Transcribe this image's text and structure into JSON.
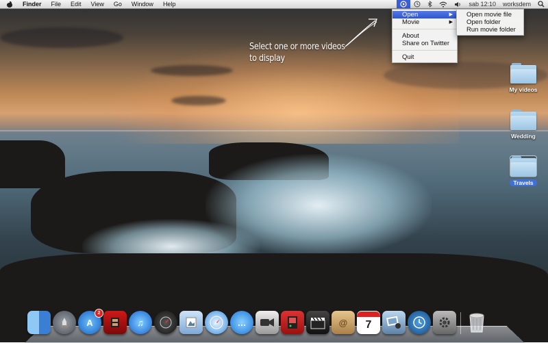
{
  "menubar": {
    "apple_icon": "apple-icon",
    "app_name": "Finder",
    "menus": [
      "File",
      "Edit",
      "View",
      "Go",
      "Window",
      "Help"
    ],
    "status": {
      "app_icon": "play-circle-icon",
      "icons": [
        "time-machine-icon",
        "bluetooth-icon",
        "wifi-icon",
        "volume-icon"
      ],
      "clock": "sab 12:10",
      "user": "worksdem",
      "search_icon": "spotlight-search-icon"
    }
  },
  "app_menu": {
    "items": [
      {
        "label": "Open",
        "has_submenu": true,
        "highlighted": true
      },
      {
        "label": "Movie",
        "has_submenu": true,
        "highlighted": false
      },
      {
        "label": "About",
        "has_submenu": false,
        "highlighted": false
      },
      {
        "label": "Share on Twitter",
        "has_submenu": false,
        "highlighted": false
      },
      {
        "label": "Quit",
        "has_submenu": false,
        "highlighted": false
      }
    ],
    "submenu": [
      "Open movie file",
      "Open folder",
      "Run movie folder"
    ]
  },
  "hint": {
    "line1": "Select one or more videos",
    "line2": "to display"
  },
  "desktop_items": [
    {
      "label": "My videos",
      "selected": false
    },
    {
      "label": "Wedding",
      "selected": false
    },
    {
      "label": "Travels",
      "selected": true
    }
  ],
  "dock": {
    "app_store_badge": "2",
    "calendar_day": "7",
    "items": [
      "finder-icon",
      "launchpad-icon",
      "app-store-icon",
      "photo-booth-icon",
      "itunes-icon",
      "dashboard-icon",
      "preview-icon",
      "safari-icon",
      "messages-icon",
      "facetime-icon",
      "photo-app-icon",
      "final-cut-icon",
      "address-book-icon",
      "ical-icon",
      "iphoto-icon",
      "time-machine-icon",
      "system-preferences-icon",
      "trash-icon"
    ]
  },
  "colors": {
    "menu_highlight": "#3b5dd6",
    "label_selected": "#3f6fd8"
  }
}
